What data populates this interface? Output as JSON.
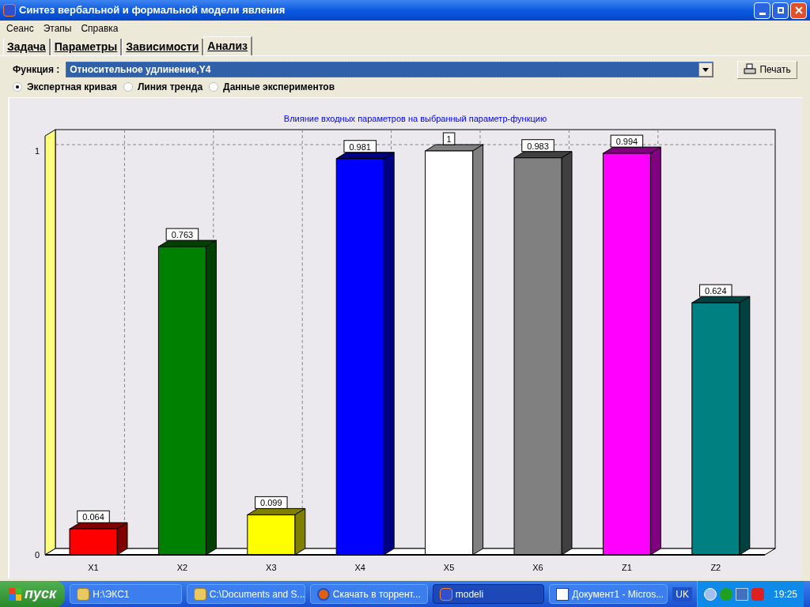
{
  "window": {
    "title": "Синтез вербальной и формальной модели явления"
  },
  "menu": [
    "Сеанс",
    "Этапы",
    "Справка"
  ],
  "tabs": [
    {
      "label": "Задача",
      "selected": false
    },
    {
      "label": "Параметры",
      "selected": false
    },
    {
      "label": "Зависимости",
      "selected": false
    },
    {
      "label": "Анализ",
      "selected": true
    }
  ],
  "function": {
    "label": "Функция :",
    "value": "Относительное удлинение,Y4"
  },
  "print_button": "Печать",
  "modes": [
    {
      "label": "Экспертная кривая",
      "selected": true
    },
    {
      "label": "Линия тренда",
      "selected": false
    },
    {
      "label": "Данные экспериментов",
      "selected": false
    }
  ],
  "chart": {
    "chart_data": {
      "type": "bar",
      "title": "Влияние входных параметров на  выбранный параметр-функцию",
      "categories": [
        "X1",
        "X2",
        "X3",
        "X4",
        "X5",
        "X6",
        "Z1",
        "Z2"
      ],
      "series": [
        {
          "values": [
            0.064,
            0.763,
            0.099,
            0.981,
            1,
            0.983,
            0.994,
            0.624
          ]
        }
      ],
      "colors": [
        "#ff0000",
        "#008000",
        "#ffff00",
        "#0000ff",
        "#ffffff",
        "#808080",
        "#ff00ff",
        "#008080"
      ],
      "value_labels": [
        "0.064",
        "0.763",
        "0.099",
        "0.981",
        "1",
        "0.983",
        "0.994",
        "0.624"
      ],
      "ylim": [
        0,
        1
      ],
      "yticks": [
        0,
        1
      ]
    }
  },
  "taskbar": {
    "start": "пуск",
    "items": [
      {
        "label": "H:\\ЭКС1",
        "selected": false,
        "kind": "folder"
      },
      {
        "label": "C:\\Documents and S...",
        "selected": false,
        "kind": "folder"
      },
      {
        "label": "Скачать в торрент...",
        "selected": false,
        "kind": "browser"
      },
      {
        "label": "modeli",
        "selected": true,
        "kind": "app"
      },
      {
        "label": "Документ1 - Micros...",
        "selected": false,
        "kind": "document"
      }
    ],
    "language": "UK",
    "time": "19:25"
  }
}
